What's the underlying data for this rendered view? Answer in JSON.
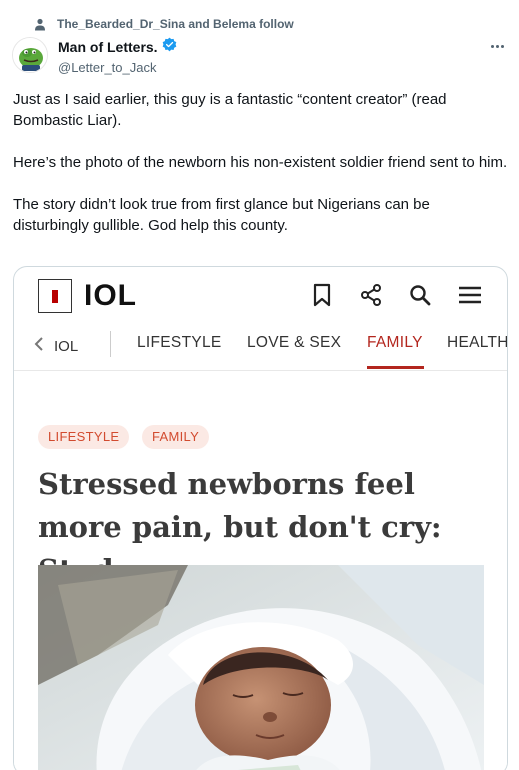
{
  "social_context": {
    "text": "The_Bearded_Dr_Sina and Belema follow",
    "icon": "person-icon"
  },
  "author": {
    "name": "Man of Letters.",
    "handle": "@Letter_to_Jack",
    "verified": true,
    "verified_color": "#1d9bf0"
  },
  "tweet": {
    "paragraphs": [
      "Just as I said earlier, this guy is a fantastic “content creator” (read Bombastic Liar).",
      "Here’s the photo of the newborn his non-existent soldier friend sent to him.",
      "The story didn’t look true from first glance but Nigerians can be disturbingly gullible. God help this county."
    ]
  },
  "embed": {
    "logo_text": "IOL",
    "nav": {
      "back_label": "IOL",
      "items": [
        "LIFESTYLE",
        "LOVE & SEX",
        "FAMILY",
        "HEALTH"
      ],
      "active": "FAMILY"
    },
    "tags": [
      "LIFESTYLE",
      "FAMILY"
    ],
    "headline": "Stressed newborns feel more pain, but don't cry: Study",
    "accent_color": "#b3261e"
  }
}
